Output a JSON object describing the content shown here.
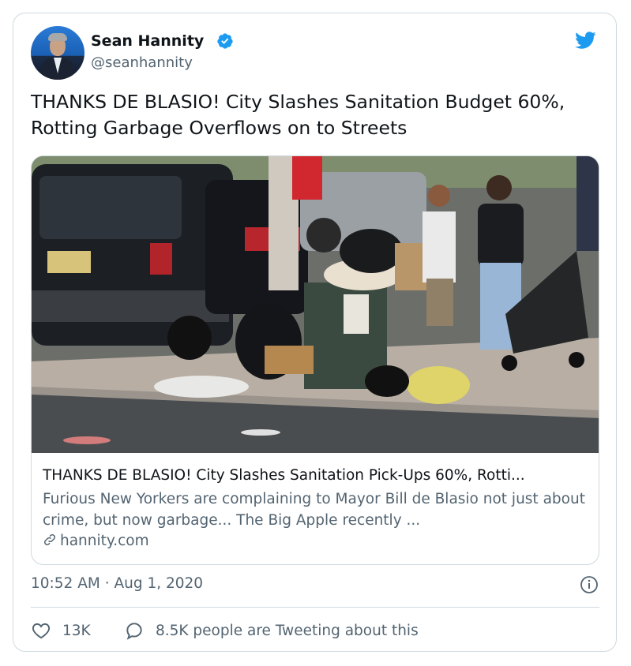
{
  "author": {
    "name": "Sean Hannity",
    "handle": "@seanhannity",
    "verified": true
  },
  "tweet": {
    "text": "THANKS DE BLASIO! City Slashes Sanitation Budget 60%, Rotting Garbage Overflows on to Streets"
  },
  "link_card": {
    "image_description": "street-garbage-photo",
    "title": "THANKS DE BLASIO! City Slashes Sanitation Pick-Ups 60%, Rotti...",
    "description": "Furious New Yorkers are complaining to Mayor Bill de Blasio not just about crime, but now garbage... The Big Apple recently ...",
    "domain": "hannity.com"
  },
  "meta": {
    "timestamp": "10:52 AM · Aug 1, 2020"
  },
  "actions": {
    "likes": "13K",
    "tweeting_about": "8.5K people are Tweeting about this"
  },
  "icons": {
    "verified": "verified-badge-icon",
    "brand": "twitter-bird-icon",
    "info": "info-icon",
    "like": "heart-icon",
    "reply": "speech-bubble-icon",
    "link": "link-icon"
  },
  "colors": {
    "brand_blue": "#1d9bf0",
    "text_primary": "#0f1419",
    "text_secondary": "#536471",
    "border": "#cfd9de"
  }
}
